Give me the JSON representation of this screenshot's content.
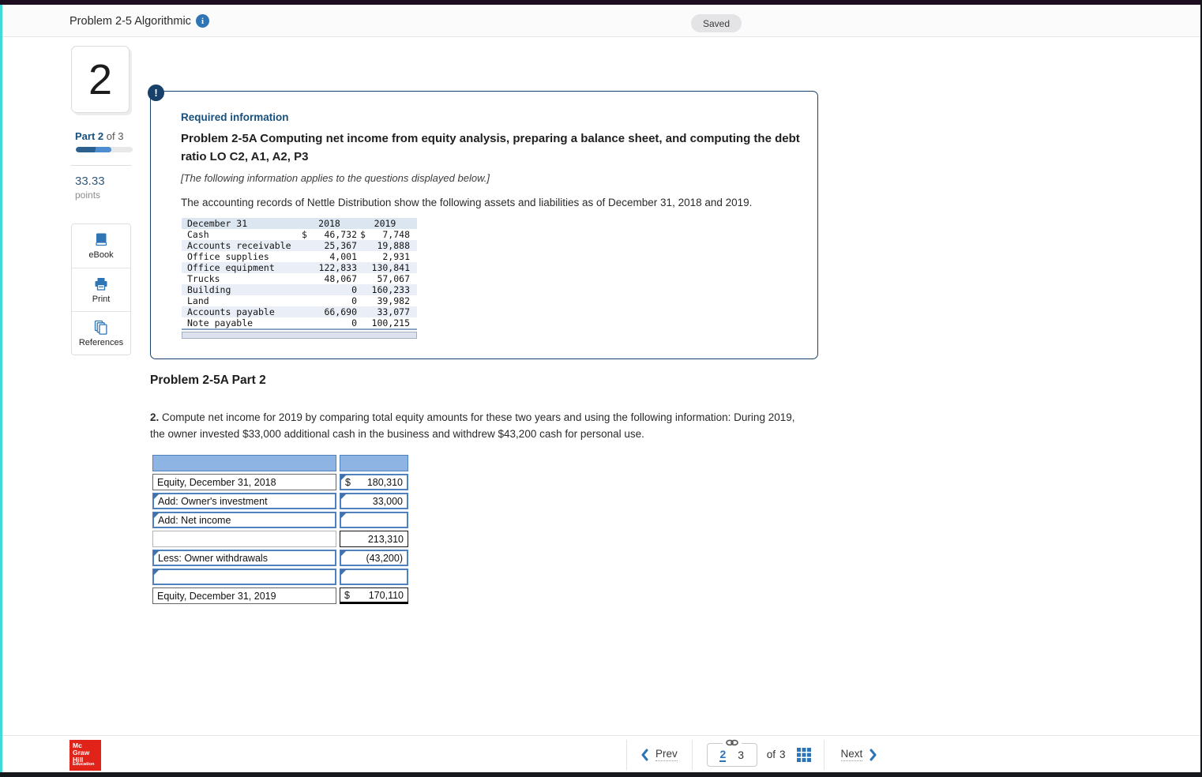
{
  "colors": {
    "accent_navy": "#17416b",
    "link_blue": "#2e75b6",
    "input_border_blue": "#4f81bd",
    "table_header_blue": "#8db4e2",
    "edge_cyan": "#3edcd4",
    "mcgraw_red": "#e2231a"
  },
  "top_bar": {
    "title": "Problem 2-5 Algorithmic",
    "saved_label": "Saved"
  },
  "sidebar": {
    "question_number": "2",
    "part_strong": "Part 2",
    "part_rest": "of 3",
    "progress_percent": 63,
    "points_value": "33.33",
    "points_label": "points",
    "tools": [
      {
        "label": "eBook",
        "icon": "book-icon"
      },
      {
        "label": "Print",
        "icon": "printer-icon"
      },
      {
        "label": "References",
        "icon": "pages-icon"
      }
    ]
  },
  "required_info": {
    "alert_glyph": "!",
    "heading": "Required information",
    "title": "Problem 2-5A Computing net income from equity analysis, preparing a balance sheet, and computing the debt ratio LO C2, A1, A2, P3",
    "note": "[The following information applies to the questions displayed below.]",
    "body": "The accounting records of Nettle Distribution show the following assets and liabilities as of December 31, 2018 and 2019.",
    "accounting_table": {
      "headers": [
        "December 31",
        "2018",
        "2019"
      ],
      "rows": [
        {
          "name": "Cash",
          "dollar": true,
          "y2018": "46,732",
          "y2019": "7,748"
        },
        {
          "name": "Accounts receivable",
          "dollar": false,
          "y2018": "25,367",
          "y2019": "19,888"
        },
        {
          "name": "Office supplies",
          "dollar": false,
          "y2018": "4,001",
          "y2019": "2,931"
        },
        {
          "name": "Office equipment",
          "dollar": false,
          "y2018": "122,833",
          "y2019": "130,841"
        },
        {
          "name": "Trucks",
          "dollar": false,
          "y2018": "48,067",
          "y2019": "57,067"
        },
        {
          "name": "Building",
          "dollar": false,
          "y2018": "0",
          "y2019": "160,233"
        },
        {
          "name": "Land",
          "dollar": false,
          "y2018": "0",
          "y2019": "39,982"
        },
        {
          "name": "Accounts payable",
          "dollar": false,
          "y2018": "66,690",
          "y2019": "33,077"
        },
        {
          "name": "Note payable",
          "dollar": false,
          "y2018": "0",
          "y2019": "100,215"
        }
      ]
    }
  },
  "part_section": {
    "heading": "Problem 2-5A Part 2",
    "question_number": "2.",
    "question_text": "Compute net income for 2019 by comparing total equity amounts for these two years and using the following information: During 2019, the owner invested $33,000 additional cash in the business and withdrew $43,200 cash for personal use."
  },
  "worksheet": {
    "rows": [
      {
        "label": "Equity, December 31, 2018",
        "label_style": "static",
        "dollar": "$",
        "value": "180,310",
        "value_style": "input"
      },
      {
        "label": "Add: Owner's investment",
        "label_style": "input",
        "dollar": "",
        "value": "33,000",
        "value_style": "input"
      },
      {
        "label": "Add: Net income",
        "label_style": "input",
        "dollar": "",
        "value": "",
        "value_style": "input"
      },
      {
        "label": "",
        "label_style": "plain",
        "dollar": "",
        "value": "213,310",
        "value_style": "computed"
      },
      {
        "label": "Less: Owner withdrawals",
        "label_style": "input",
        "dollar": "",
        "value": "(43,200)",
        "value_style": "input"
      },
      {
        "label": "",
        "label_style": "input",
        "dollar": "",
        "value": "",
        "value_style": "input"
      },
      {
        "label": "Equity, December 31, 2019",
        "label_style": "static",
        "dollar": "$",
        "value": "170,110",
        "value_style": "total"
      }
    ]
  },
  "footer": {
    "logo_lines": [
      "Mc",
      "Graw",
      "Hill",
      "Education"
    ],
    "prev_label": "Prev",
    "page_current": "2",
    "page_linked": "3",
    "of_label": "of",
    "total_pages": "3",
    "next_label": "Next"
  }
}
